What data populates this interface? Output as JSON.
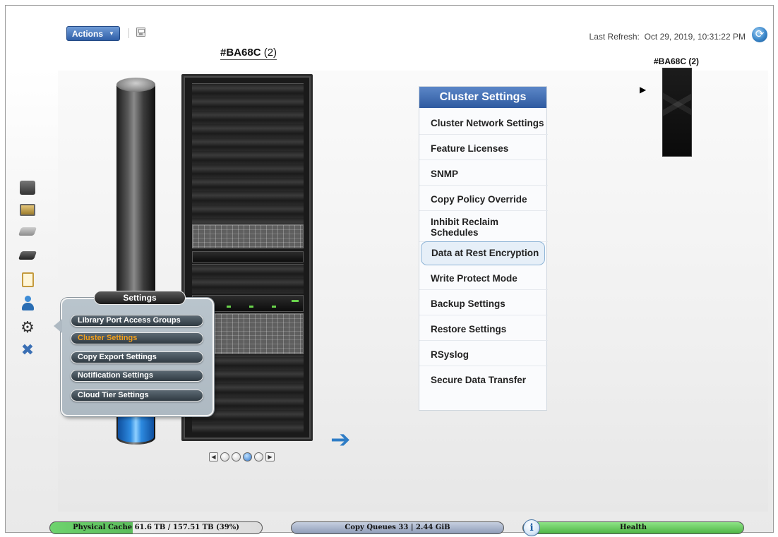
{
  "toolbar": {
    "actions_label": "Actions",
    "last_refresh_label": "Last Refresh:",
    "last_refresh_value": "Oct 29, 2019, 10:31:22 PM"
  },
  "cluster": {
    "name": "#BA68C",
    "count": "(2)",
    "mini_label": "#BA68C (2)"
  },
  "left_rail": {
    "icons": [
      "systems-icon",
      "monitor-icon",
      "disk-icon",
      "drive-icon",
      "clipboard-icon",
      "user-icon",
      "gear-icon",
      "tools-icon"
    ]
  },
  "settings_popup": {
    "title": "Settings",
    "items": [
      {
        "label": "Library Port Access Groups",
        "active": false
      },
      {
        "label": "Cluster Settings",
        "active": true
      },
      {
        "label": "Copy Export Settings",
        "active": false
      },
      {
        "label": "Notification Settings",
        "active": false
      },
      {
        "label": "Cloud Tier Settings",
        "active": false
      }
    ],
    "active_color": "#f2a01d"
  },
  "cluster_settings_menu": {
    "title": "Cluster Settings",
    "items": [
      {
        "label": "Cluster Network Settings",
        "active": false
      },
      {
        "label": "Feature Licenses",
        "active": false
      },
      {
        "label": "SNMP",
        "active": false
      },
      {
        "label": "Copy Policy Override",
        "active": false
      },
      {
        "label": "Inhibit Reclaim Schedules",
        "active": false
      },
      {
        "label": "Data at Rest Encryption",
        "active": true
      },
      {
        "label": "Write Protect Mode",
        "active": false
      },
      {
        "label": "Backup Settings",
        "active": false
      },
      {
        "label": "Restore Settings",
        "active": false
      },
      {
        "label": "RSyslog",
        "active": false
      },
      {
        "label": "Secure Data Transfer",
        "active": false
      }
    ],
    "header_color": "#2e5aa0"
  },
  "carousel": {
    "pages": 4,
    "active_page": 3
  },
  "status_bar": {
    "cache_label": "Physical Cache 61.6 TB / 157.51 TB (39%)",
    "cache_fraction": 0.39,
    "queues_label": "Copy Queues 33 | 2.44 GiB",
    "health_label": "Health",
    "health_color": "#4fb545"
  }
}
